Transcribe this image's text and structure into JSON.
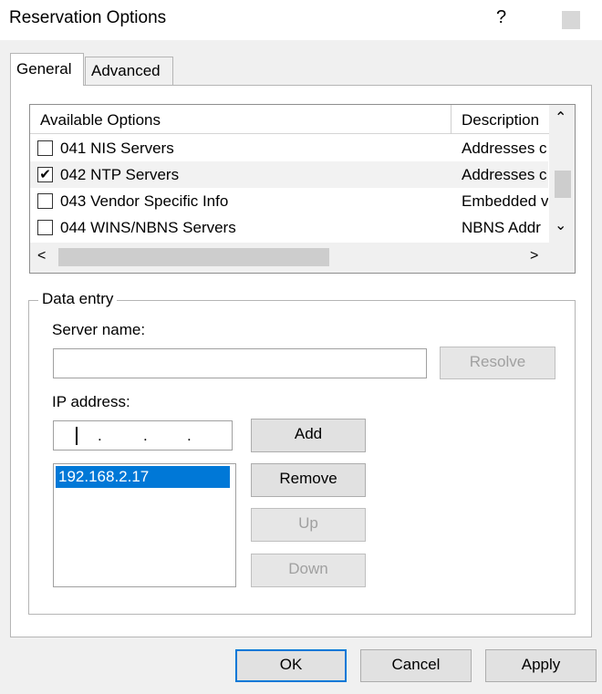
{
  "window": {
    "title": "Reservation Options",
    "help_label": "?"
  },
  "tabs": [
    {
      "label": "General",
      "active": true
    },
    {
      "label": "Advanced",
      "active": false
    }
  ],
  "options_list": {
    "columns": [
      "Available Options",
      "Description"
    ],
    "rows": [
      {
        "name": "041 NIS Servers",
        "description": "Addresses c",
        "checked": false
      },
      {
        "name": "042 NTP Servers",
        "description": "Addresses c",
        "checked": true
      },
      {
        "name": "043 Vendor Specific Info",
        "description": "Embedded v",
        "checked": false
      },
      {
        "name": "044 WINS/NBNS Servers",
        "description": "NBNS Addr",
        "checked": false
      }
    ],
    "check_glyph": "✔",
    "scroll_up": "⌃",
    "scroll_down": "⌄",
    "scroll_left": "<",
    "scroll_right": ">"
  },
  "data_entry": {
    "group_label": "Data entry",
    "server_name_label": "Server name:",
    "server_name_value": "",
    "resolve_label": "Resolve",
    "ip_address_label": "IP address:",
    "ip_dots": [
      ".",
      ".",
      "."
    ],
    "add_label": "Add",
    "remove_label": "Remove",
    "up_label": "Up",
    "down_label": "Down",
    "ip_list": [
      "192.168.2.17"
    ]
  },
  "footer": {
    "ok_label": "OK",
    "cancel_label": "Cancel",
    "apply_label": "Apply"
  },
  "colors": {
    "accent": "#0078d7",
    "dialog_bg": "#f0f0f0",
    "disabled_text": "#a0a0a0"
  }
}
